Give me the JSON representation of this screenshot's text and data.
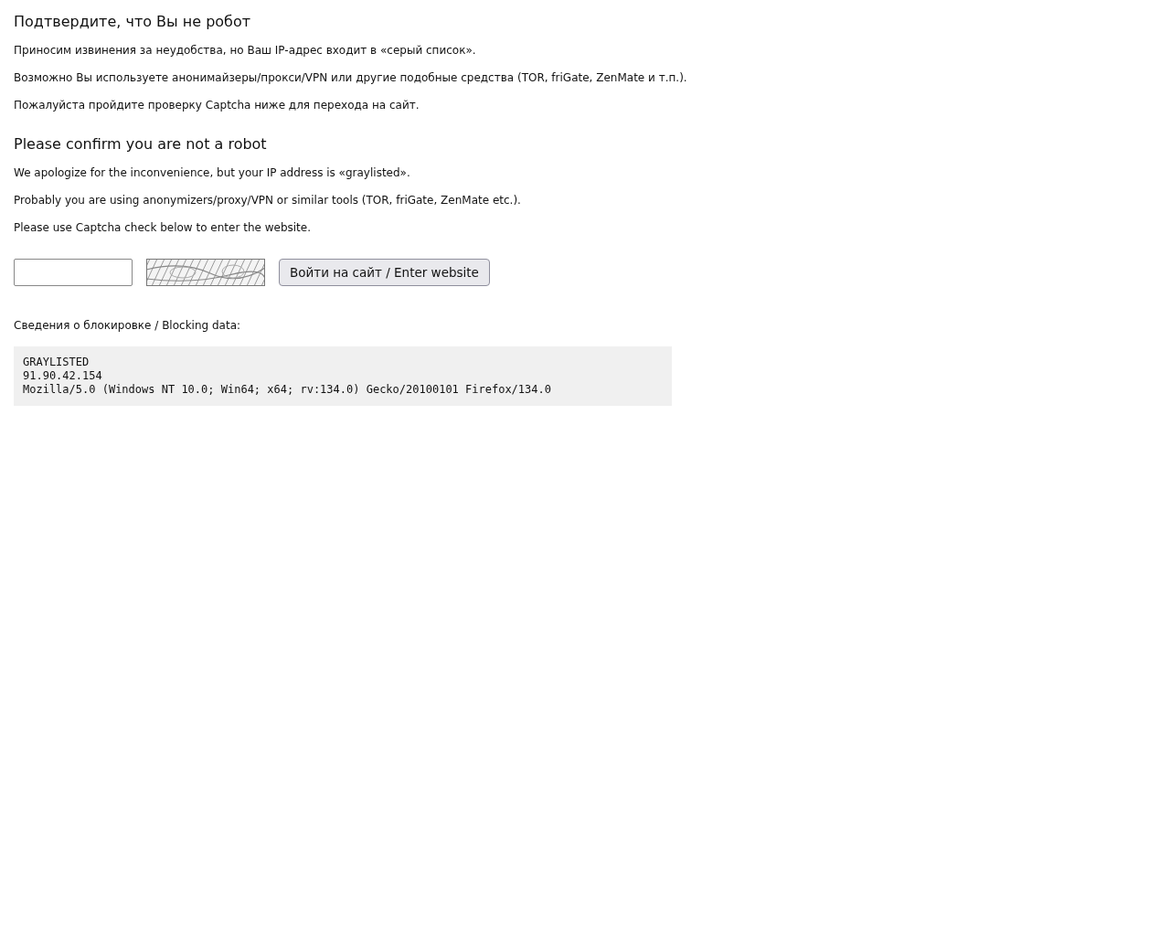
{
  "sections": [
    {
      "heading": "Подтвердите, что Вы не робот",
      "paragraphs": [
        "Приносим извинения за неудобства, но Ваш IP-адрес входит в «серый список».",
        "Возможно Вы используете анонимайзеры/прокси/VPN или другие подобные средства (TOR, friGate, ZenMate и т.п.).",
        "Пожалуйста пройдите проверку Captcha ниже для перехода на сайт."
      ]
    },
    {
      "heading": "Please confirm you are not a robot",
      "paragraphs": [
        "We apologize for the inconvenience, but your IP address is «graylisted».",
        "Probably you are using anonymizers/proxy/VPN or similar tools (TOR, friGate, ZenMate etc.).",
        "Please use Captcha check below to enter the website."
      ]
    }
  ],
  "captcha": {
    "submit": "Войти на сайт / Enter website"
  },
  "blocking": {
    "label": "Сведения о блокировке / Blocking data:",
    "lines": [
      "GRAYLISTED",
      "91.90.42.154",
      "Mozilla/5.0 (Windows NT 10.0; Win64; x64; rv:134.0) Gecko/20100101 Firefox/134.0"
    ]
  }
}
